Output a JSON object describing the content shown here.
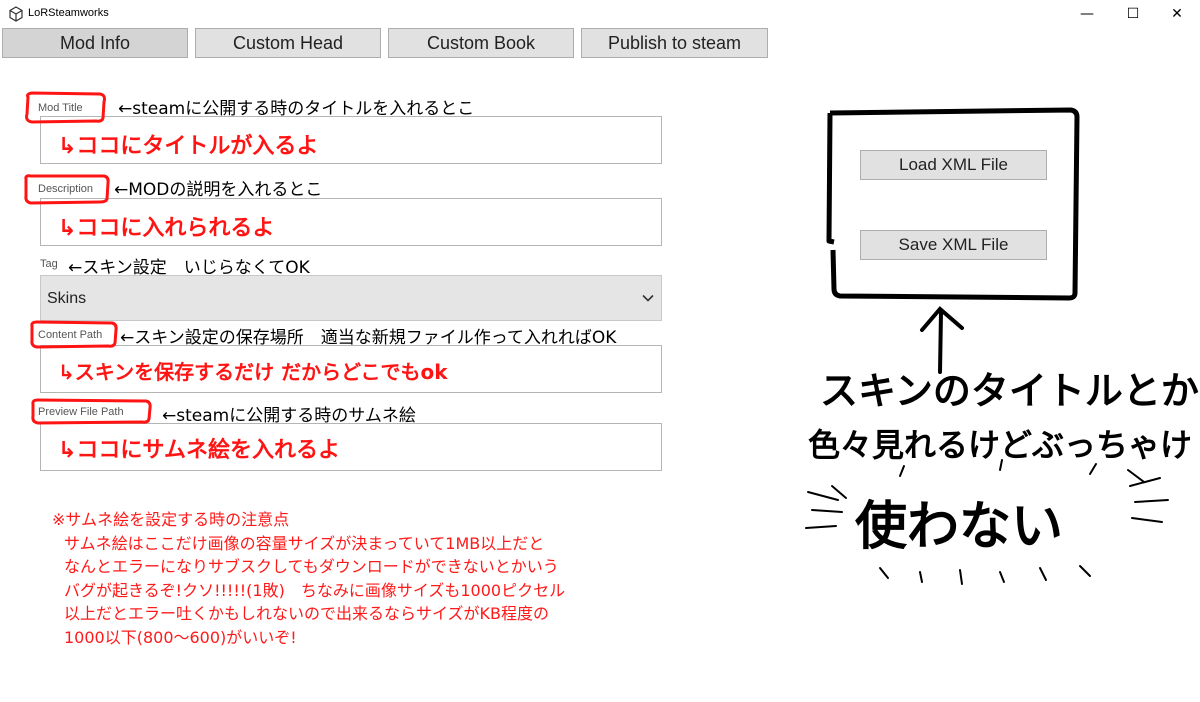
{
  "window": {
    "title": "LoRSteamworks",
    "minimize_glyph": "—",
    "maximize_glyph": "☐",
    "close_glyph": "✕"
  },
  "tabs": [
    {
      "label": "Mod Info",
      "active": true
    },
    {
      "label": "Custom Head",
      "active": false
    },
    {
      "label": "Custom Book",
      "active": false
    },
    {
      "label": "Publish to steam",
      "active": false
    }
  ],
  "fields": {
    "mod_title": {
      "label": "Mod Title",
      "note": "←steamに公開する時のタイトルを入れるとこ",
      "handwritten": "↳ココにタイトルが入るよ"
    },
    "description": {
      "label": "Description",
      "note": "←MODの説明を入れるとこ",
      "handwritten": "↳ココに入れられるよ"
    },
    "tag": {
      "label": "Tag",
      "note": "←スキン設定　いじらなくてOK",
      "value": "Skins"
    },
    "content_path": {
      "label": "Content Path",
      "note": "←スキン設定の保存場所　適当な新規ファイル作って入れればOK",
      "handwritten": "↳スキンを保存するだけ だからどこでもok"
    },
    "preview_path": {
      "label": "Preview File Path",
      "note": "←steamに公開する時のサムネ絵",
      "handwritten": "↳ココにサムネ絵を入れるよ"
    }
  },
  "warning": {
    "heading": "※サムネ絵を設定する時の注意点",
    "lines": [
      "サムネ絵はここだけ画像の容量サイズが決まっていて1MB以上だと",
      "なんとエラーになりサブスクしてもダウンロードができないとかいう",
      "バグが起きるぞ!クソ!!!!!(1敗)　ちなみに画像サイズも1000ピクセル",
      "以上だとエラー吐くかもしれないので出来るならサイズがKB程度の",
      "1000以下(800〜600)がいいぞ!"
    ]
  },
  "xml_buttons": {
    "load_label": "Load XML File",
    "save_label": "Save XML File"
  },
  "side_note": {
    "line1": "スキンのタイトルとか",
    "line2": "色々見れるけどぶっちゃけ",
    "line3": "使わない"
  },
  "icons": {
    "app": "unity-logo-icon",
    "select": "chevron-down-icon"
  },
  "colors": {
    "annotation_red": "#ff1414",
    "tab_bg": "#e1e1e1",
    "tab_active_bg": "#d4d4d4"
  }
}
